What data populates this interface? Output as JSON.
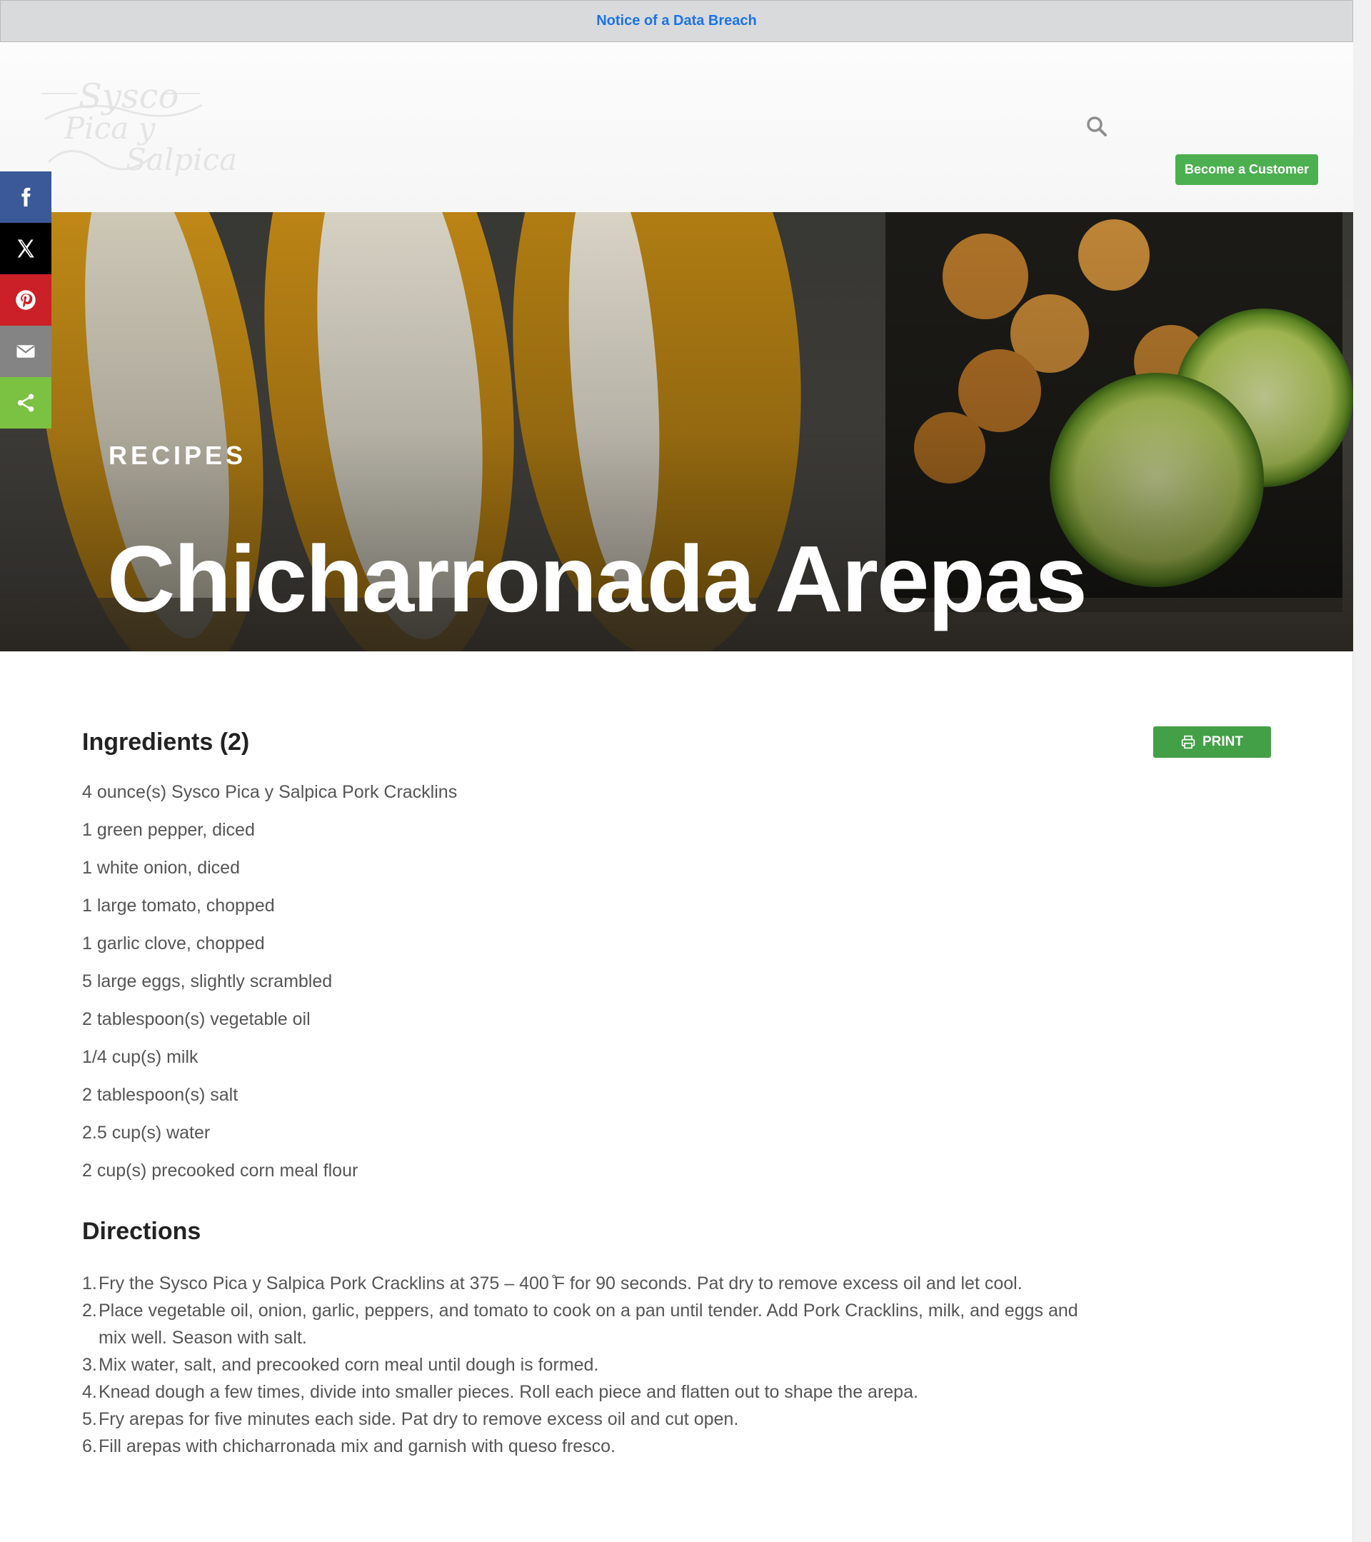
{
  "notice": {
    "link_text": "Notice of a Data Breach"
  },
  "header": {
    "logo": {
      "line1": "Sysco",
      "line2": "Pica y",
      "line3": "Salpica"
    },
    "search_icon": "search-icon",
    "cta_label": "Become a Customer",
    "cta_color": "#4caf50"
  },
  "share": {
    "buttons": [
      {
        "name": "facebook",
        "icon": "facebook-icon",
        "color": "#3b5998"
      },
      {
        "name": "x",
        "icon": "x-icon",
        "color": "#000000"
      },
      {
        "name": "pinterest",
        "icon": "pinterest-icon",
        "color": "#cb2027"
      },
      {
        "name": "email",
        "icon": "email-icon",
        "color": "#848484"
      },
      {
        "name": "share",
        "icon": "share-icon",
        "color": "#7bc142"
      }
    ]
  },
  "hero": {
    "kicker": "RECIPES",
    "title": "Chicharronada Arepas"
  },
  "ingredients": {
    "title": "Ingredients (2)",
    "print_label": "PRINT",
    "items": [
      "4 ounce(s) Sysco Pica y Salpica Pork Cracklins",
      "1 green pepper, diced",
      "1 white onion, diced",
      "1 large tomato, chopped",
      "1 garlic clove, chopped",
      "5 large eggs, slightly scrambled",
      "2 tablespoon(s) vegetable oil",
      "1/4 cup(s) milk",
      "2 tablespoon(s) salt",
      "2.5 cup(s) water",
      "2 cup(s) precooked corn meal flour"
    ]
  },
  "directions": {
    "title": "Directions",
    "steps": [
      "Fry the Sysco Pica y Salpica Pork Cracklins at 375 – 400 ̊F for 90 seconds. Pat dry to remove excess oil and let cool.",
      "Place vegetable oil, onion, garlic, peppers, and tomato to cook on a pan until tender. Add Pork Cracklins, milk, and eggs and mix well. Season with salt.",
      "Mix water, salt, and precooked corn meal until dough is formed.",
      "Knead dough a few times, divide into smaller pieces. Roll each piece and flatten out to shape the arepa.",
      "Fry arepas for five minutes each side. Pat dry to remove excess oil and cut open.",
      "Fill arepas with chicharronada mix and garnish with queso fresco."
    ]
  }
}
